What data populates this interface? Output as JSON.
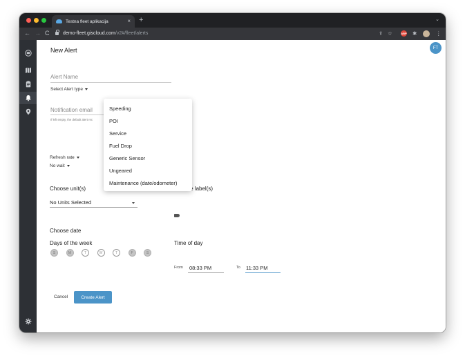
{
  "browser": {
    "tab_title": "Testna fleet aplikacija",
    "new_tab": "+",
    "tab_close": "×",
    "tab_menu": "⌄",
    "url_host": "demo-fleet.giscloud.com",
    "url_path": "/v2#/fleet/alerts",
    "adblock_label": "ABP"
  },
  "header": {
    "title": "New Alert",
    "avatar_initials": "FT"
  },
  "form": {
    "alert_name_placeholder": "Alert Name",
    "alert_type_label": "Select Alert type",
    "notification_email_placeholder": "Notification email",
    "notification_hint": "If left empty, the default alert rec",
    "refresh_rate_label": "Refresh rate",
    "refresh_rate_value": "No wait",
    "choose_units_label": "Choose unit(s)",
    "units_value": "No Units Selected",
    "choose_labels_label": "Choose label(s)",
    "choose_date_label": "Choose date",
    "days_of_week_label": "Days of the week",
    "days": [
      {
        "letter": "S",
        "selected": true
      },
      {
        "letter": "M",
        "selected": true
      },
      {
        "letter": "T",
        "selected": false
      },
      {
        "letter": "W",
        "selected": false
      },
      {
        "letter": "T",
        "selected": false
      },
      {
        "letter": "F",
        "selected": true
      },
      {
        "letter": "S",
        "selected": true
      }
    ],
    "time_of_day_label": "Time of day",
    "from_label": "From",
    "from_value": "08:33 PM",
    "to_label": "To",
    "to_value": "11:33 PM",
    "cancel_label": "Cancel",
    "create_label": "Create Alert"
  },
  "alert_type_options": [
    "Speeding",
    "POI",
    "Service",
    "Fuel Drop",
    "Generic Sensor",
    "Ungeared",
    "Maintenance (date/odometer)"
  ],
  "colors": {
    "accent": "#4b94c8",
    "sidebar": "#2d3035",
    "chrome": "#35363a"
  }
}
